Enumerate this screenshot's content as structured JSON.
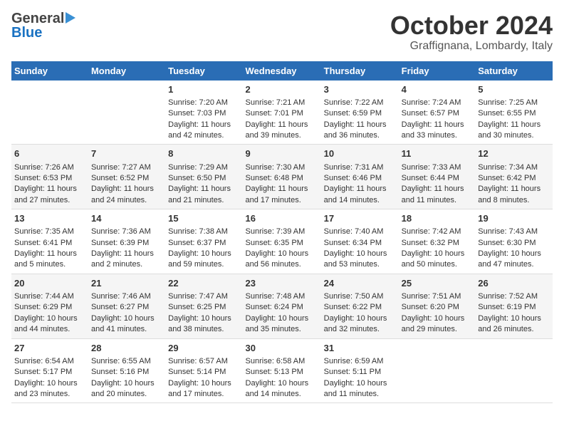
{
  "header": {
    "logo_general": "General",
    "logo_blue": "Blue",
    "title": "October 2024",
    "subtitle": "Graffignana, Lombardy, Italy"
  },
  "calendar": {
    "days_of_week": [
      "Sunday",
      "Monday",
      "Tuesday",
      "Wednesday",
      "Thursday",
      "Friday",
      "Saturday"
    ],
    "weeks": [
      [
        {
          "day": "",
          "info": ""
        },
        {
          "day": "",
          "info": ""
        },
        {
          "day": "1",
          "info": "Sunrise: 7:20 AM\nSunset: 7:03 PM\nDaylight: 11 hours and 42 minutes."
        },
        {
          "day": "2",
          "info": "Sunrise: 7:21 AM\nSunset: 7:01 PM\nDaylight: 11 hours and 39 minutes."
        },
        {
          "day": "3",
          "info": "Sunrise: 7:22 AM\nSunset: 6:59 PM\nDaylight: 11 hours and 36 minutes."
        },
        {
          "day": "4",
          "info": "Sunrise: 7:24 AM\nSunset: 6:57 PM\nDaylight: 11 hours and 33 minutes."
        },
        {
          "day": "5",
          "info": "Sunrise: 7:25 AM\nSunset: 6:55 PM\nDaylight: 11 hours and 30 minutes."
        }
      ],
      [
        {
          "day": "6",
          "info": "Sunrise: 7:26 AM\nSunset: 6:53 PM\nDaylight: 11 hours and 27 minutes."
        },
        {
          "day": "7",
          "info": "Sunrise: 7:27 AM\nSunset: 6:52 PM\nDaylight: 11 hours and 24 minutes."
        },
        {
          "day": "8",
          "info": "Sunrise: 7:29 AM\nSunset: 6:50 PM\nDaylight: 11 hours and 21 minutes."
        },
        {
          "day": "9",
          "info": "Sunrise: 7:30 AM\nSunset: 6:48 PM\nDaylight: 11 hours and 17 minutes."
        },
        {
          "day": "10",
          "info": "Sunrise: 7:31 AM\nSunset: 6:46 PM\nDaylight: 11 hours and 14 minutes."
        },
        {
          "day": "11",
          "info": "Sunrise: 7:33 AM\nSunset: 6:44 PM\nDaylight: 11 hours and 11 minutes."
        },
        {
          "day": "12",
          "info": "Sunrise: 7:34 AM\nSunset: 6:42 PM\nDaylight: 11 hours and 8 minutes."
        }
      ],
      [
        {
          "day": "13",
          "info": "Sunrise: 7:35 AM\nSunset: 6:41 PM\nDaylight: 11 hours and 5 minutes."
        },
        {
          "day": "14",
          "info": "Sunrise: 7:36 AM\nSunset: 6:39 PM\nDaylight: 11 hours and 2 minutes."
        },
        {
          "day": "15",
          "info": "Sunrise: 7:38 AM\nSunset: 6:37 PM\nDaylight: 10 hours and 59 minutes."
        },
        {
          "day": "16",
          "info": "Sunrise: 7:39 AM\nSunset: 6:35 PM\nDaylight: 10 hours and 56 minutes."
        },
        {
          "day": "17",
          "info": "Sunrise: 7:40 AM\nSunset: 6:34 PM\nDaylight: 10 hours and 53 minutes."
        },
        {
          "day": "18",
          "info": "Sunrise: 7:42 AM\nSunset: 6:32 PM\nDaylight: 10 hours and 50 minutes."
        },
        {
          "day": "19",
          "info": "Sunrise: 7:43 AM\nSunset: 6:30 PM\nDaylight: 10 hours and 47 minutes."
        }
      ],
      [
        {
          "day": "20",
          "info": "Sunrise: 7:44 AM\nSunset: 6:29 PM\nDaylight: 10 hours and 44 minutes."
        },
        {
          "day": "21",
          "info": "Sunrise: 7:46 AM\nSunset: 6:27 PM\nDaylight: 10 hours and 41 minutes."
        },
        {
          "day": "22",
          "info": "Sunrise: 7:47 AM\nSunset: 6:25 PM\nDaylight: 10 hours and 38 minutes."
        },
        {
          "day": "23",
          "info": "Sunrise: 7:48 AM\nSunset: 6:24 PM\nDaylight: 10 hours and 35 minutes."
        },
        {
          "day": "24",
          "info": "Sunrise: 7:50 AM\nSunset: 6:22 PM\nDaylight: 10 hours and 32 minutes."
        },
        {
          "day": "25",
          "info": "Sunrise: 7:51 AM\nSunset: 6:20 PM\nDaylight: 10 hours and 29 minutes."
        },
        {
          "day": "26",
          "info": "Sunrise: 7:52 AM\nSunset: 6:19 PM\nDaylight: 10 hours and 26 minutes."
        }
      ],
      [
        {
          "day": "27",
          "info": "Sunrise: 6:54 AM\nSunset: 5:17 PM\nDaylight: 10 hours and 23 minutes."
        },
        {
          "day": "28",
          "info": "Sunrise: 6:55 AM\nSunset: 5:16 PM\nDaylight: 10 hours and 20 minutes."
        },
        {
          "day": "29",
          "info": "Sunrise: 6:57 AM\nSunset: 5:14 PM\nDaylight: 10 hours and 17 minutes."
        },
        {
          "day": "30",
          "info": "Sunrise: 6:58 AM\nSunset: 5:13 PM\nDaylight: 10 hours and 14 minutes."
        },
        {
          "day": "31",
          "info": "Sunrise: 6:59 AM\nSunset: 5:11 PM\nDaylight: 10 hours and 11 minutes."
        },
        {
          "day": "",
          "info": ""
        },
        {
          "day": "",
          "info": ""
        }
      ]
    ]
  }
}
